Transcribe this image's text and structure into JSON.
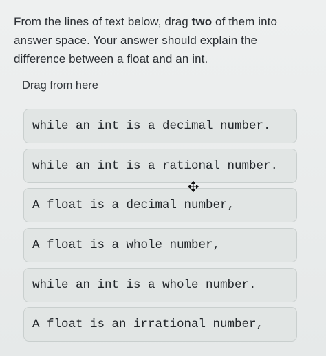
{
  "question": {
    "text_before_bold": "From the lines of text below, drag ",
    "bold_word": "two",
    "text_after_bold": " of them into answer space. Your answer should explain the difference between a float and an int."
  },
  "drag_area": {
    "label": "Drag from here"
  },
  "options": [
    {
      "text": "while an int is a decimal number."
    },
    {
      "text": "while an int is a rational number."
    },
    {
      "text": "A float is a decimal number,"
    },
    {
      "text": "A float is a whole number,"
    },
    {
      "text": "while an int is a whole number."
    },
    {
      "text": "A float is an irrational number,"
    }
  ],
  "cursor": {
    "icon": "move-cursor-icon"
  }
}
